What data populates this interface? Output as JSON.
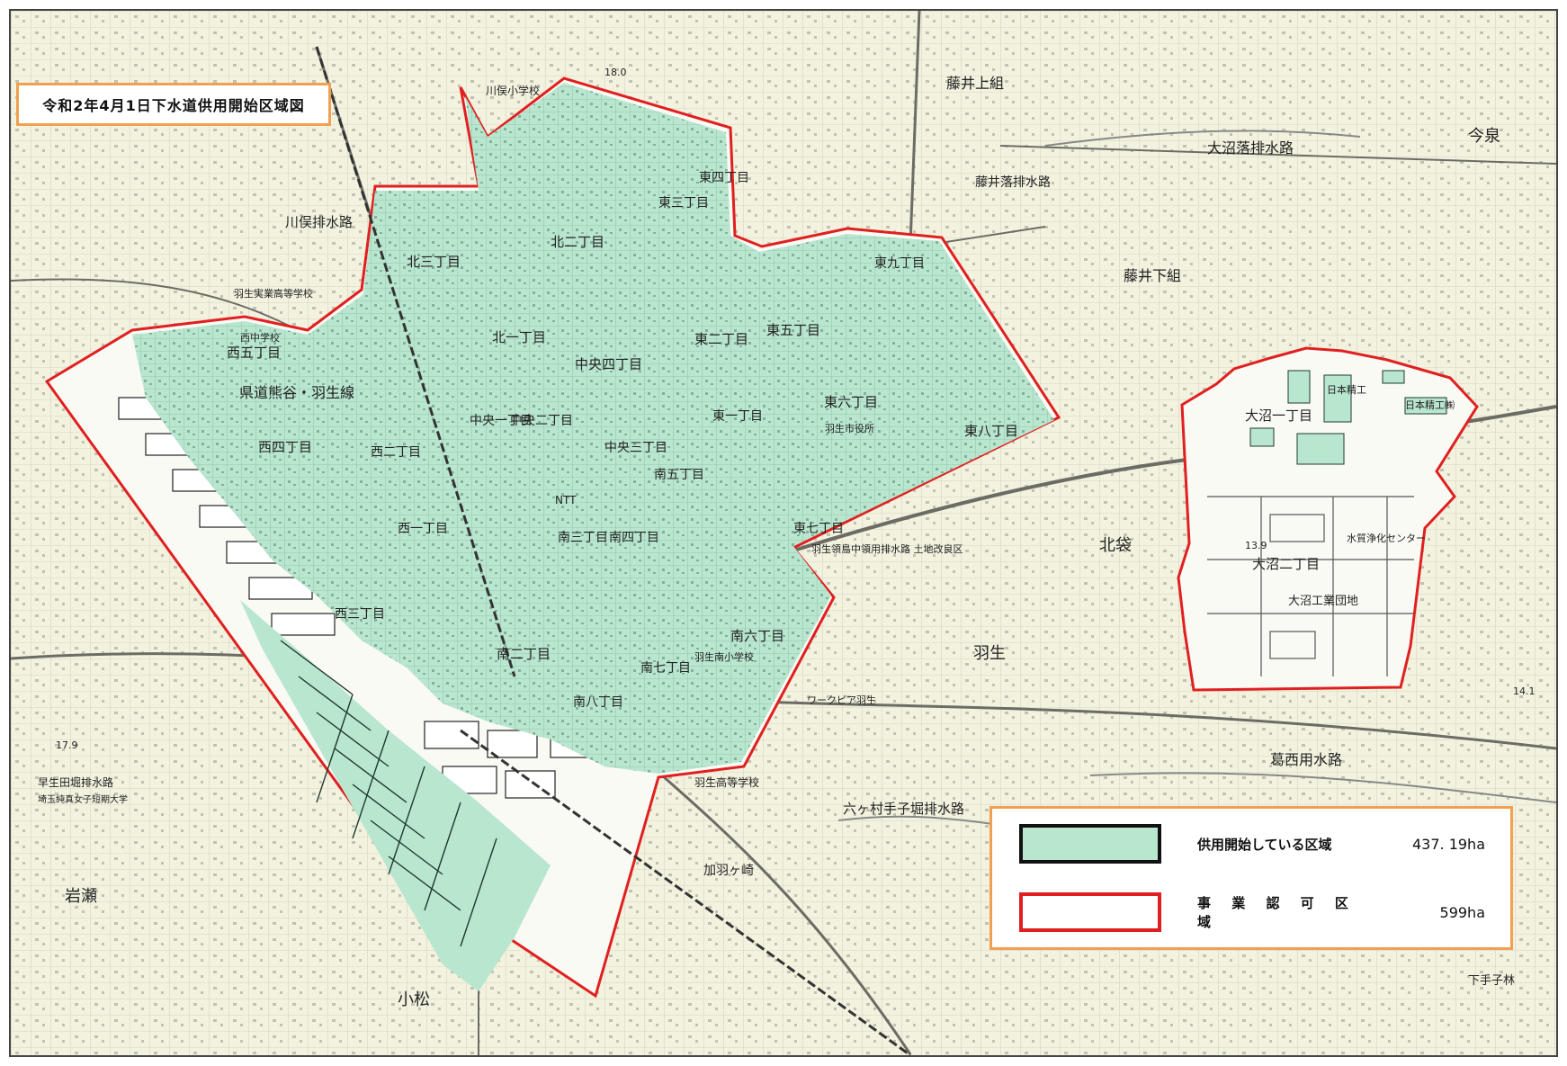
{
  "title": "令和2年4月1日下水道供用開始区域図",
  "legend": {
    "served_label": "供用開始している区域",
    "served_value": "437. 19ha",
    "approved_label": "事 業 認 可 区 域",
    "approved_value": "599ha"
  },
  "colors": {
    "served_fill": "#b9e6cf",
    "approved_border": "#e02020",
    "legend_frame": "#f0a050",
    "map_paper": "#f3f2df"
  },
  "map_labels": {
    "kita_sanchome": "北三丁目",
    "kita_nichome": "北二丁目",
    "kita_itchome": "北一丁目",
    "higashi_yonchome": "東四丁目",
    "higashi_sanchome": "東三丁目",
    "higashi_kyuchome": "東九丁目",
    "higashi_nichome": "東二丁目",
    "higashi_gochome": "東五丁目",
    "higashi_itchome": "東一丁目",
    "higashi_rokuchome": "東六丁目",
    "higashi_hatchome": "東八丁目",
    "higashi_nanachome": "東七丁目",
    "nishi_gochome": "西五丁目",
    "nishi_yonchome": "西四丁目",
    "nishi_nichome": "西二丁目",
    "nishi_itchome": "西一丁目",
    "nishi_sanchome": "西三丁目",
    "chuo_yonchome": "中央四丁目",
    "chuo_itchome": "中央一丁目",
    "chuo_nichome": "中央二丁目",
    "chuo_sanchome": "中央三丁目",
    "minami_gochome": "南五丁目",
    "minami_sanchome": "南三丁目",
    "minami_yonchome": "南四丁目",
    "minami_nichome": "南二丁目",
    "minami_rokuchome": "南六丁目",
    "minami_nanachome": "南七丁目",
    "minami_hatchome": "南八丁目",
    "onuma_itchome": "大沼一丁目",
    "onuma_nichome": "大沼二丁目",
    "prefectural_road": "県道熊谷・羽生線",
    "kawamata_school": "川俣小学校",
    "nishi_chugakko": "西中学校",
    "hanyu_jitsugyo": "羽生実業高等学校",
    "kawamata_drain": "川俣排水路",
    "fujii_kamigumi": "藤井上組",
    "fujii_shimogumi": "藤井下組",
    "onuma_drain": "大沼落排水路",
    "fujii_drain": "藤井落排水路",
    "nippon_seiko": "日本精工",
    "nippon_seiko_k": "日本精工㈱",
    "ntt": "NTT",
    "hanyu_city_hall": "羽生市役所",
    "suishitsu_center": "水質浄化センター",
    "onuma_kogyo": "大沼工業団地",
    "kuze_drain": "葛西用水路",
    "rokkamura_drain": "六ヶ村手子堀排水路",
    "hanyu_koko": "羽生高等学校",
    "hanyu": "羽生",
    "imaizumi": "今泉",
    "kitabukuro": "北袋",
    "iwase": "岩瀬",
    "komatsu": "小松",
    "shimoteko": "下手子林",
    "kaba": "加羽ヶ崎",
    "hanyu_jsk": "羽生領島中領用排水路 土地改良区",
    "sayaka": "早生田堀排水路",
    "saitama_junior": "埼玉純真女子短期大学",
    "hanyu_minami": "羽生南小学校",
    "shushoku_center": "ワークピア羽生",
    "mile1": "18.0",
    "mile2": "14.1",
    "mile3": "17.9",
    "mile4": "13.9"
  }
}
